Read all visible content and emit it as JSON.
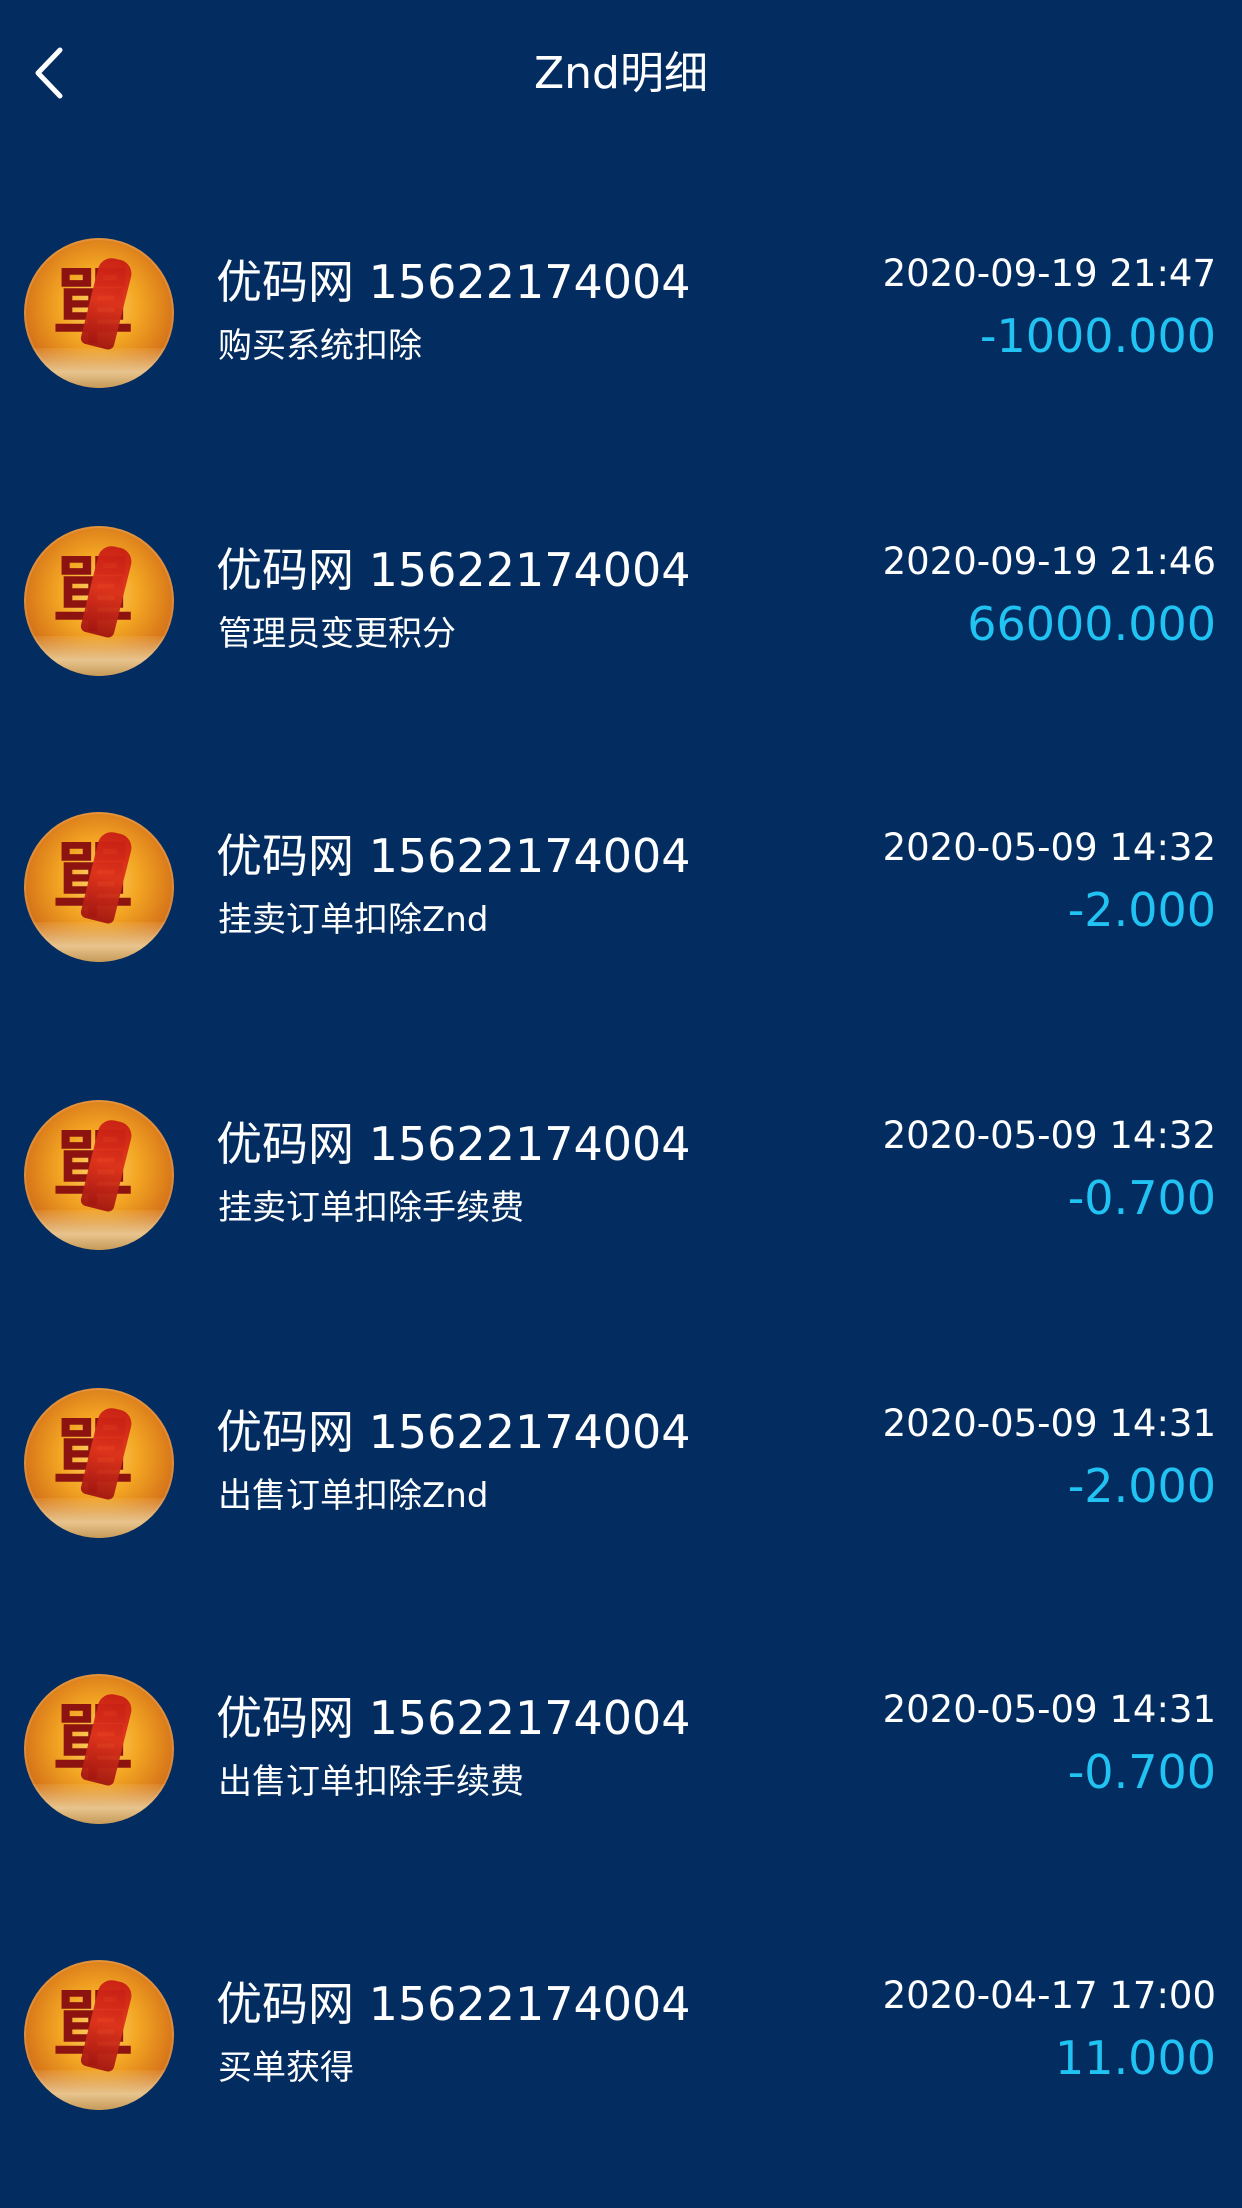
{
  "header": {
    "title": "Znd明细",
    "back_icon": "chevron-left-icon"
  },
  "colors": {
    "background": "#032d60",
    "text": "#ffffff",
    "amount": "#21c3f2"
  },
  "records": [
    {
      "name": "优码网  15622174004",
      "desc": "购买系统扣除",
      "time": "2020-09-19 21:47",
      "amount": "-1000.000"
    },
    {
      "name": "优码网  15622174004",
      "desc": "管理员变更积分",
      "time": "2020-09-19 21:46",
      "amount": "66000.000"
    },
    {
      "name": "优码网  15622174004",
      "desc": "挂卖订单扣除Znd",
      "time": "2020-05-09 14:32",
      "amount": "-2.000"
    },
    {
      "name": "优码网  15622174004",
      "desc": "挂卖订单扣除手续费",
      "time": "2020-05-09 14:32",
      "amount": "-0.700"
    },
    {
      "name": "优码网  15622174004",
      "desc": "出售订单扣除Znd",
      "time": "2020-05-09 14:31",
      "amount": "-2.000"
    },
    {
      "name": "优码网  15622174004",
      "desc": "出售订单扣除手续费",
      "time": "2020-05-09 14:31",
      "amount": "-0.700"
    },
    {
      "name": "优码网  15622174004",
      "desc": "买单获得",
      "time": "2020-04-17 17:00",
      "amount": "11.000"
    }
  ]
}
